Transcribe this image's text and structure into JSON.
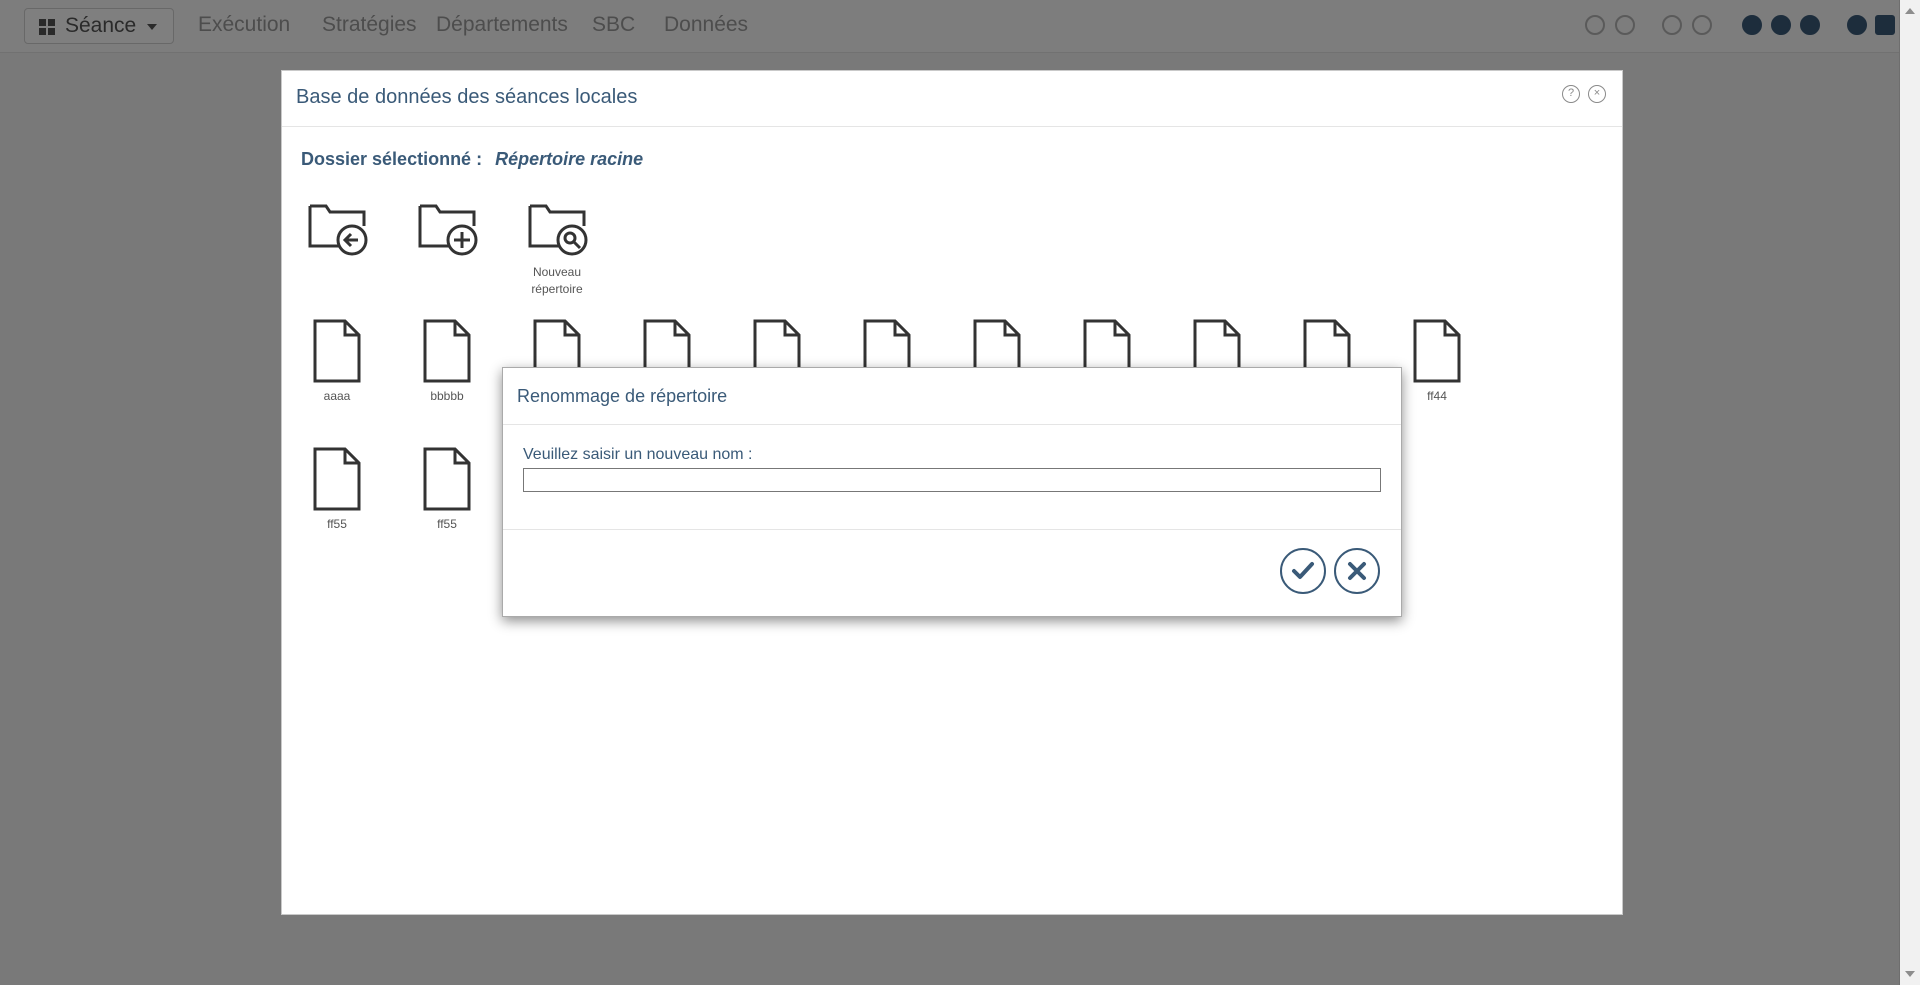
{
  "topbar": {
    "app_menu_label": "Séance",
    "menu_items": [
      "Exécution",
      "Stratégies",
      "Départements",
      "SBC",
      "Données"
    ],
    "toolbar_icons": [
      "save-icon",
      "save-as-icon",
      "undo-icon",
      "redo-icon",
      "settings-icon",
      "help-icon",
      "bug-icon",
      "logout-icon",
      "close-icon"
    ]
  },
  "db_dialog": {
    "title": "Base de données des séances locales",
    "selected_folder_label": "Dossier sélectionné :",
    "selected_folder_value": "Répertoire racine",
    "folder_actions": [
      {
        "icon": "folder-back-icon",
        "label": ""
      },
      {
        "icon": "folder-add-icon",
        "label": ""
      },
      {
        "icon": "folder-search-icon",
        "label": "Nouveau répertoire"
      }
    ],
    "files": [
      {
        "label": "aaaa"
      },
      {
        "label": "bbbbb"
      },
      {
        "label": ""
      },
      {
        "label": ""
      },
      {
        "label": ""
      },
      {
        "label": ""
      },
      {
        "label": ""
      },
      {
        "label": ""
      },
      {
        "label": ""
      },
      {
        "label": ""
      },
      {
        "label": "ff44"
      },
      {
        "label": "ff55"
      },
      {
        "label": "ff55"
      }
    ]
  },
  "rename_dialog": {
    "title": "Renommage de répertoire",
    "prompt": "Veuillez saisir un nouveau nom :",
    "input_value": "",
    "confirm_icon": "check-icon",
    "cancel_icon": "x-icon"
  },
  "colors": {
    "accent": "#3a5a78",
    "overlay": "rgba(0,0,0,0.5)"
  }
}
